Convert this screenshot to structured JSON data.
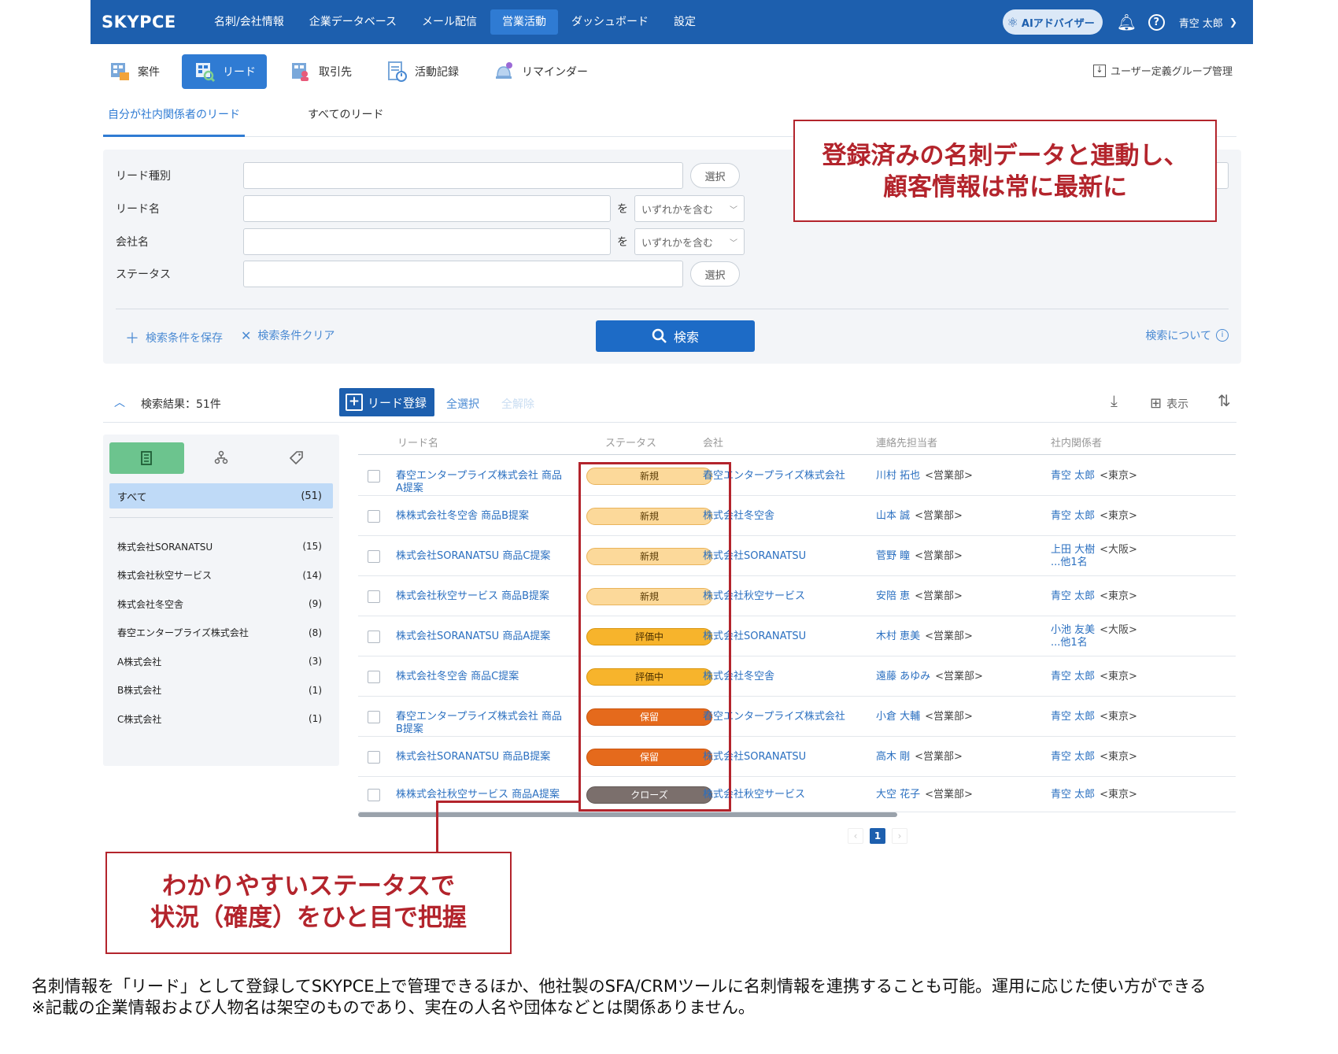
{
  "app": {
    "logo": "SKYPCE",
    "nav": [
      "名刺/会社情報",
      "企業データベース",
      "メール配信",
      "営業活動",
      "ダッシュボード",
      "設定"
    ],
    "nav_active_index": 3,
    "ai_button": "AIアドバイザー",
    "user_name": "青空 太郎"
  },
  "subnav": {
    "items": [
      {
        "label": "案件",
        "icon": "deal-icon"
      },
      {
        "label": "リード",
        "icon": "lead-icon",
        "active": true
      },
      {
        "label": "取引先",
        "icon": "account-icon"
      },
      {
        "label": "活動記録",
        "icon": "activity-log-icon"
      },
      {
        "label": "リマインダー",
        "icon": "reminder-bell-icon"
      }
    ],
    "group_mgmt": "ユーザー定義グループ管理"
  },
  "tabs": [
    "自分が社内関係者のリード",
    "すべてのリード"
  ],
  "search": {
    "labels": [
      "リード種別",
      "リード名",
      "会社名",
      "ステータス"
    ],
    "select_label": "選択",
    "wo": "を",
    "match_option": "いずれかを含む",
    "save_conditions": "検索条件を保存",
    "clear_conditions": "検索条件クリア",
    "search_button": "検索",
    "about_search": "検索について"
  },
  "results": {
    "count_label": "検索結果：51件",
    "add_lead": "リード登録",
    "select_all": "全選択",
    "deselect_all": "全解除",
    "view_label": "表示"
  },
  "filter": {
    "all_label": "すべて",
    "all_count": "(51)",
    "companies": [
      {
        "name": "株式会社SORANATSU",
        "count": "(15)"
      },
      {
        "name": "株式会社秋空サービス",
        "count": "(14)"
      },
      {
        "name": "株式会社冬空舎",
        "count": "(9)"
      },
      {
        "name": "春空エンタープライズ株式会社",
        "count": "(8)"
      },
      {
        "name": "A株式会社",
        "count": "(3)"
      },
      {
        "name": "B株式会社",
        "count": "(1)"
      },
      {
        "name": "C株式会社",
        "count": "(1)"
      }
    ]
  },
  "table": {
    "headers": [
      "リード名",
      "ステータス",
      "会社",
      "連絡先担当者",
      "社内関係者"
    ],
    "rows": [
      {
        "lead": "春空エンタープライズ株式会社 商品A提案",
        "status": "新規",
        "status_kind": "new",
        "company": "春空エンタープライズ株式会社",
        "contact": "川村 拓也",
        "contact_dept": "<営業部>",
        "internal": "青空 太郎",
        "internal_loc": "<東京>",
        "internal_more": ""
      },
      {
        "lead": "株株式会社冬空舎 商品B提案",
        "status": "新規",
        "status_kind": "new",
        "company": "株式会社冬空舎",
        "contact": "山本 誠",
        "contact_dept": "<営業部>",
        "internal": "青空 太郎",
        "internal_loc": "<東京>",
        "internal_more": ""
      },
      {
        "lead": "株式会社SORANATSU 商品C提案",
        "status": "新規",
        "status_kind": "new",
        "company": "株式会社SORANATSU",
        "contact": "菅野 瞳",
        "contact_dept": "<営業部>",
        "internal": "上田 大樹",
        "internal_loc": "<大阪>",
        "internal_more": "...他1名"
      },
      {
        "lead": "株式会社秋空サービス 商品B提案",
        "status": "新規",
        "status_kind": "new",
        "company": "株式会社秋空サービス",
        "contact": "安陪 恵",
        "contact_dept": "<営業部>",
        "internal": "青空 太郎",
        "internal_loc": "<東京>",
        "internal_more": ""
      },
      {
        "lead": "株式会社SORANATSU 商品A提案",
        "status": "評価中",
        "status_kind": "eval",
        "company": "株式会社SORANATSU",
        "contact": "木村 恵美",
        "contact_dept": "<営業部>",
        "internal": "小池 友美",
        "internal_loc": "<大阪>",
        "internal_more": "...他1名"
      },
      {
        "lead": "株式会社冬空舎 商品C提案",
        "status": "評価中",
        "status_kind": "eval",
        "company": "株式会社冬空舎",
        "contact": "遠藤 あゆみ",
        "contact_dept": "<営業部>",
        "internal": "青空 太郎",
        "internal_loc": "<東京>",
        "internal_more": ""
      },
      {
        "lead": "春空エンタープライズ株式会社 商品B提案",
        "status": "保留",
        "status_kind": "hold",
        "company": "春空エンタープライズ株式会社",
        "contact": "小倉 大輔",
        "contact_dept": "<営業部>",
        "internal": "青空 太郎",
        "internal_loc": "<東京>",
        "internal_more": ""
      },
      {
        "lead": "株式会社SORANATSU 商品B提案",
        "status": "保留",
        "status_kind": "hold",
        "company": "株式会社SORANATSU",
        "contact": "高木 剛",
        "contact_dept": "<営業部>",
        "internal": "青空 太郎",
        "internal_loc": "<東京>",
        "internal_more": ""
      },
      {
        "lead": "株株式会社秋空サービス 商品A提案",
        "status": "クローズ",
        "status_kind": "closed",
        "company": "株式会社秋空サービス",
        "contact": "大空 花子",
        "contact_dept": "<営業部>",
        "internal": "青空 太郎",
        "internal_loc": "<東京>",
        "internal_more": ""
      }
    ]
  },
  "pagination": {
    "current": "1"
  },
  "callouts": {
    "top_line1": "登録済みの名刺データと連動し、",
    "top_line2": "顧客情報は常に最新に",
    "bottom_line1": "わかりやすいステータスで",
    "bottom_line2": "状況（確度）をひと目で把握"
  },
  "footnotes": [
    "名刺情報を「リード」として登録してSKYPCE上で管理できるほか、他社製のSFA/CRMツールに名刺情報を連携することも可能。運用に応じた使い方ができる",
    "※記載の企業情報および人物名は架空のものであり、実在の人名や団体などとは関係ありません。"
  ],
  "colors": {
    "brand": "#1d5fae",
    "accent": "#2f7bd3",
    "callout_red": "#b3242c",
    "status_new": "#fcd99a",
    "status_eval": "#f7b42c",
    "status_hold": "#e56a1c",
    "status_closed": "#7b6f6c"
  }
}
